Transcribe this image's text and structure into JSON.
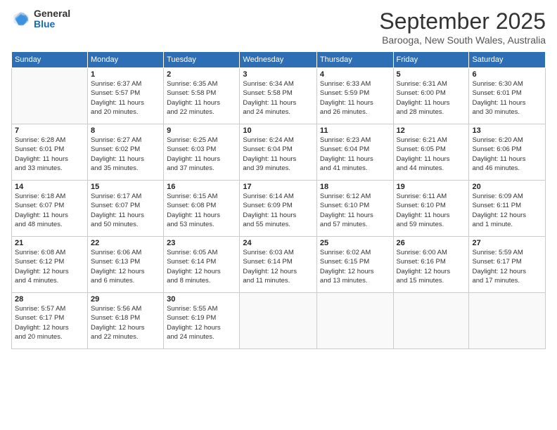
{
  "logo": {
    "general": "General",
    "blue": "Blue"
  },
  "title": "September 2025",
  "subtitle": "Barooga, New South Wales, Australia",
  "days": [
    "Sunday",
    "Monday",
    "Tuesday",
    "Wednesday",
    "Thursday",
    "Friday",
    "Saturday"
  ],
  "weeks": [
    [
      {
        "num": "",
        "info": ""
      },
      {
        "num": "1",
        "info": "Sunrise: 6:37 AM\nSunset: 5:57 PM\nDaylight: 11 hours\nand 20 minutes."
      },
      {
        "num": "2",
        "info": "Sunrise: 6:35 AM\nSunset: 5:58 PM\nDaylight: 11 hours\nand 22 minutes."
      },
      {
        "num": "3",
        "info": "Sunrise: 6:34 AM\nSunset: 5:58 PM\nDaylight: 11 hours\nand 24 minutes."
      },
      {
        "num": "4",
        "info": "Sunrise: 6:33 AM\nSunset: 5:59 PM\nDaylight: 11 hours\nand 26 minutes."
      },
      {
        "num": "5",
        "info": "Sunrise: 6:31 AM\nSunset: 6:00 PM\nDaylight: 11 hours\nand 28 minutes."
      },
      {
        "num": "6",
        "info": "Sunrise: 6:30 AM\nSunset: 6:01 PM\nDaylight: 11 hours\nand 30 minutes."
      }
    ],
    [
      {
        "num": "7",
        "info": "Sunrise: 6:28 AM\nSunset: 6:01 PM\nDaylight: 11 hours\nand 33 minutes."
      },
      {
        "num": "8",
        "info": "Sunrise: 6:27 AM\nSunset: 6:02 PM\nDaylight: 11 hours\nand 35 minutes."
      },
      {
        "num": "9",
        "info": "Sunrise: 6:25 AM\nSunset: 6:03 PM\nDaylight: 11 hours\nand 37 minutes."
      },
      {
        "num": "10",
        "info": "Sunrise: 6:24 AM\nSunset: 6:04 PM\nDaylight: 11 hours\nand 39 minutes."
      },
      {
        "num": "11",
        "info": "Sunrise: 6:23 AM\nSunset: 6:04 PM\nDaylight: 11 hours\nand 41 minutes."
      },
      {
        "num": "12",
        "info": "Sunrise: 6:21 AM\nSunset: 6:05 PM\nDaylight: 11 hours\nand 44 minutes."
      },
      {
        "num": "13",
        "info": "Sunrise: 6:20 AM\nSunset: 6:06 PM\nDaylight: 11 hours\nand 46 minutes."
      }
    ],
    [
      {
        "num": "14",
        "info": "Sunrise: 6:18 AM\nSunset: 6:07 PM\nDaylight: 11 hours\nand 48 minutes."
      },
      {
        "num": "15",
        "info": "Sunrise: 6:17 AM\nSunset: 6:07 PM\nDaylight: 11 hours\nand 50 minutes."
      },
      {
        "num": "16",
        "info": "Sunrise: 6:15 AM\nSunset: 6:08 PM\nDaylight: 11 hours\nand 53 minutes."
      },
      {
        "num": "17",
        "info": "Sunrise: 6:14 AM\nSunset: 6:09 PM\nDaylight: 11 hours\nand 55 minutes."
      },
      {
        "num": "18",
        "info": "Sunrise: 6:12 AM\nSunset: 6:10 PM\nDaylight: 11 hours\nand 57 minutes."
      },
      {
        "num": "19",
        "info": "Sunrise: 6:11 AM\nSunset: 6:10 PM\nDaylight: 11 hours\nand 59 minutes."
      },
      {
        "num": "20",
        "info": "Sunrise: 6:09 AM\nSunset: 6:11 PM\nDaylight: 12 hours\nand 1 minute."
      }
    ],
    [
      {
        "num": "21",
        "info": "Sunrise: 6:08 AM\nSunset: 6:12 PM\nDaylight: 12 hours\nand 4 minutes."
      },
      {
        "num": "22",
        "info": "Sunrise: 6:06 AM\nSunset: 6:13 PM\nDaylight: 12 hours\nand 6 minutes."
      },
      {
        "num": "23",
        "info": "Sunrise: 6:05 AM\nSunset: 6:14 PM\nDaylight: 12 hours\nand 8 minutes."
      },
      {
        "num": "24",
        "info": "Sunrise: 6:03 AM\nSunset: 6:14 PM\nDaylight: 12 hours\nand 11 minutes."
      },
      {
        "num": "25",
        "info": "Sunrise: 6:02 AM\nSunset: 6:15 PM\nDaylight: 12 hours\nand 13 minutes."
      },
      {
        "num": "26",
        "info": "Sunrise: 6:00 AM\nSunset: 6:16 PM\nDaylight: 12 hours\nand 15 minutes."
      },
      {
        "num": "27",
        "info": "Sunrise: 5:59 AM\nSunset: 6:17 PM\nDaylight: 12 hours\nand 17 minutes."
      }
    ],
    [
      {
        "num": "28",
        "info": "Sunrise: 5:57 AM\nSunset: 6:17 PM\nDaylight: 12 hours\nand 20 minutes."
      },
      {
        "num": "29",
        "info": "Sunrise: 5:56 AM\nSunset: 6:18 PM\nDaylight: 12 hours\nand 22 minutes."
      },
      {
        "num": "30",
        "info": "Sunrise: 5:55 AM\nSunset: 6:19 PM\nDaylight: 12 hours\nand 24 minutes."
      },
      {
        "num": "",
        "info": ""
      },
      {
        "num": "",
        "info": ""
      },
      {
        "num": "",
        "info": ""
      },
      {
        "num": "",
        "info": ""
      }
    ]
  ]
}
